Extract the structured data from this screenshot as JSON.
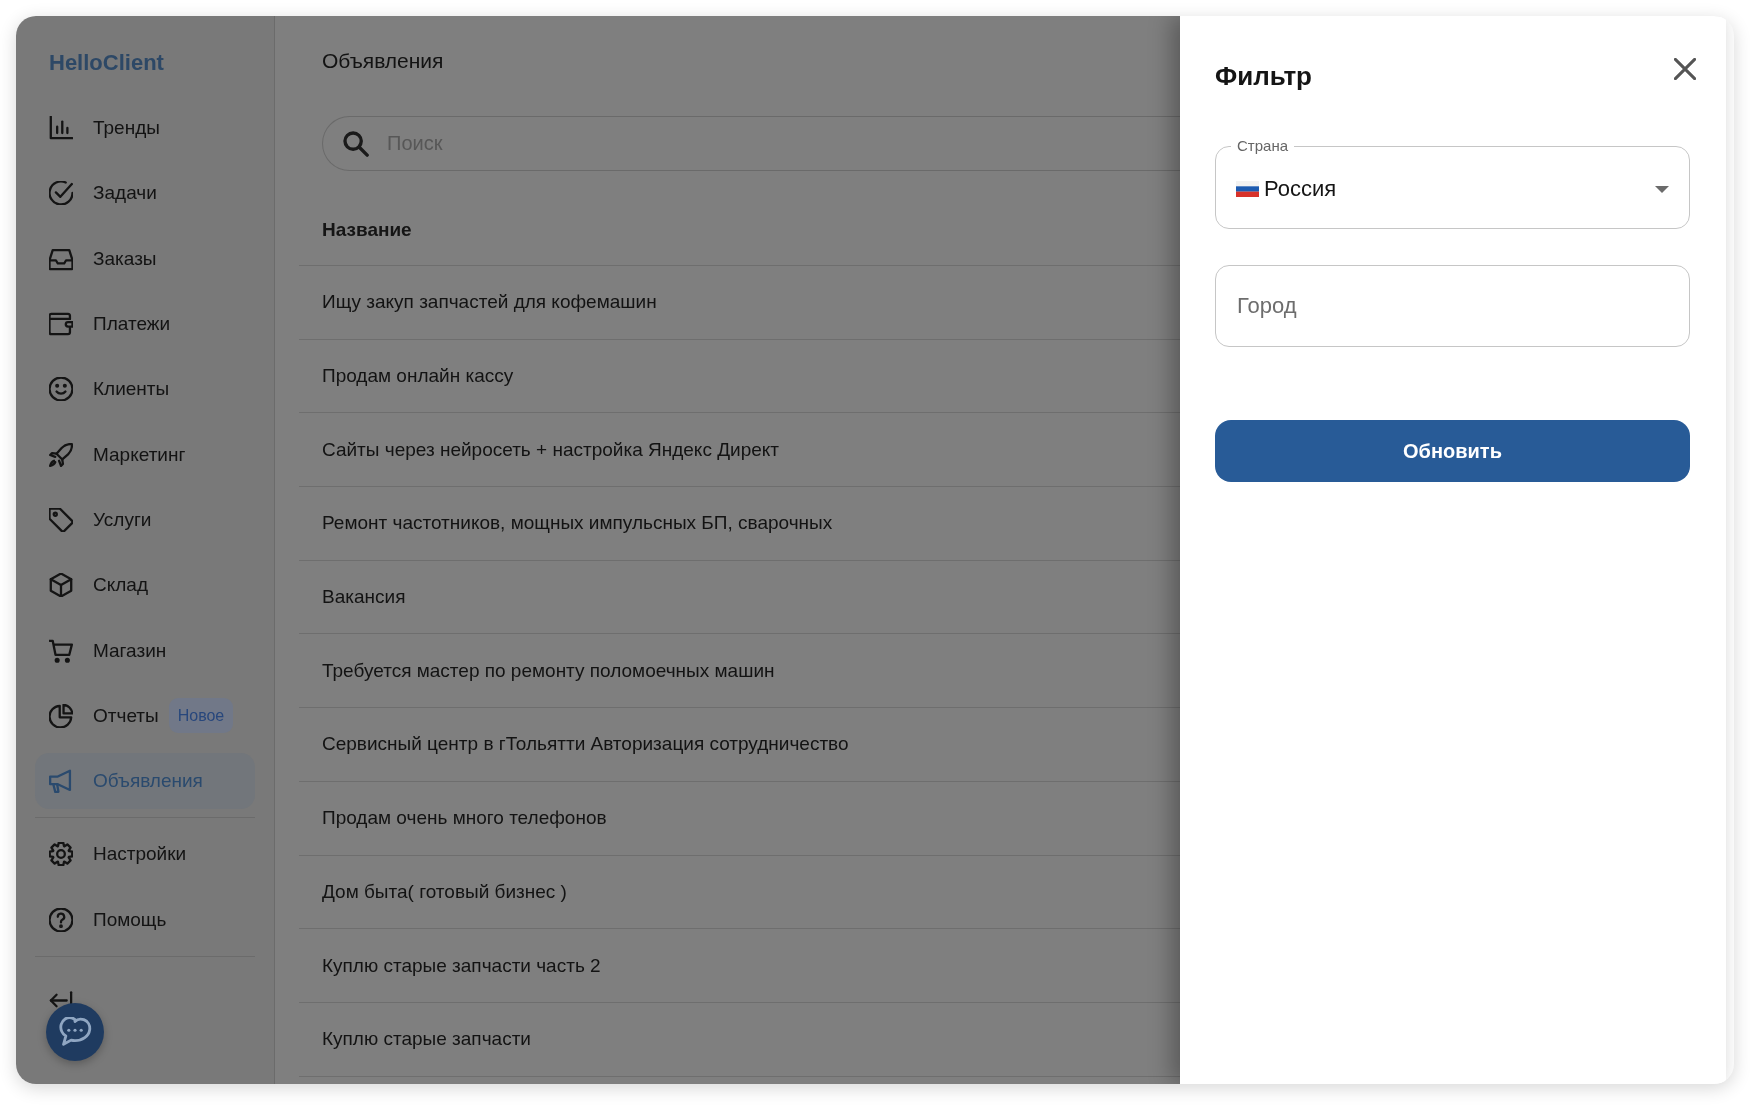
{
  "sidebar": {
    "logo": "HelloClient",
    "nav": [
      {
        "label": "Тренды",
        "selected": false
      },
      {
        "label": "Задачи",
        "selected": false
      },
      {
        "label": "Заказы",
        "selected": false
      },
      {
        "label": "Платежи",
        "selected": false
      },
      {
        "label": "Клиенты",
        "selected": false
      },
      {
        "label": "Маркетинг",
        "selected": false
      },
      {
        "label": "Услуги",
        "selected": false
      },
      {
        "label": "Склад",
        "selected": false
      },
      {
        "label": "Магазин",
        "selected": false
      },
      {
        "label": "Отчеты",
        "selected": false,
        "badge": "Новое"
      },
      {
        "label": "Объявления",
        "selected": true
      }
    ],
    "footer_nav": [
      {
        "label": "Настройки",
        "selected": false
      },
      {
        "label": "Помощь",
        "selected": false
      }
    ]
  },
  "main": {
    "title": "Объявления",
    "search": {
      "placeholder": "Поиск"
    },
    "table": {
      "columns": [
        "Название"
      ],
      "rows": [
        [
          "Ищу закуп запчастей для кофемашин"
        ],
        [
          "Продам онлайн кассу"
        ],
        [
          "Сайты через нейросеть + настройка Яндекс Директ"
        ],
        [
          "Ремонт частотников, мощных импульсных БП, сварочных"
        ],
        [
          "Вакансия"
        ],
        [
          "Требуется мастер по ремонту поломоечных машин"
        ],
        [
          "Сервисный центр в гТольятти Авторизация сотрудничество"
        ],
        [
          "Продам очень много телефонов"
        ],
        [
          "Дом быта( готовый бизнес )"
        ],
        [
          "Куплю старые запчасти часть 2"
        ],
        [
          "Куплю старые запчасти"
        ]
      ]
    }
  },
  "filter": {
    "title": "Фильтр",
    "country": {
      "label": "Страна",
      "value": "Россия"
    },
    "city": {
      "placeholder": "Город"
    },
    "submit": "Обновить"
  }
}
